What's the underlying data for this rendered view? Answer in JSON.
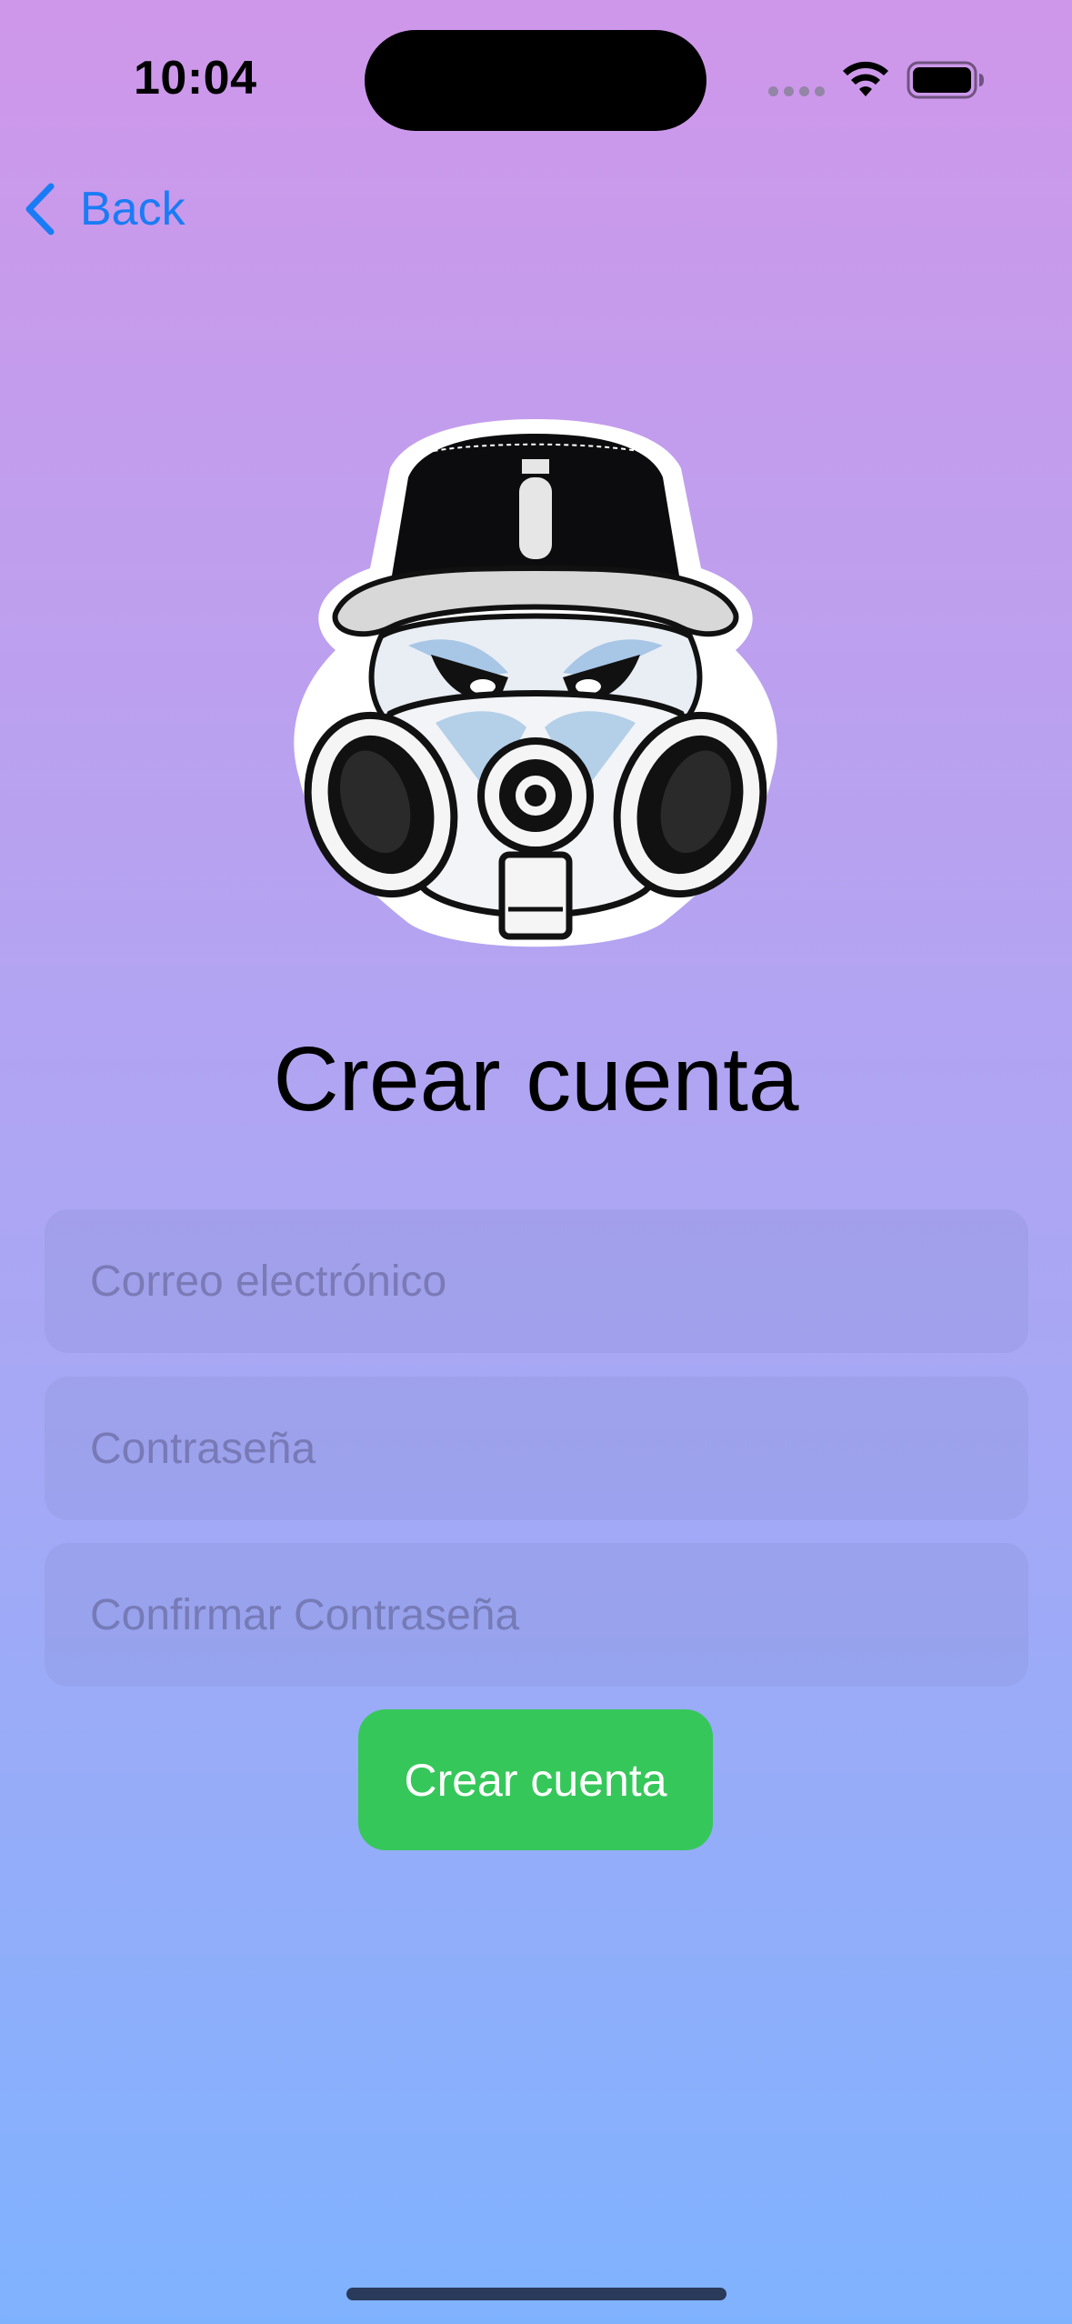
{
  "status_bar": {
    "time": "10:04",
    "icons": [
      "signal-dots-icon",
      "wifi-icon",
      "battery-icon"
    ]
  },
  "nav": {
    "back_label": "Back",
    "back_icon": "chevron-left-icon",
    "accent_color": "#1a7cf5"
  },
  "logo": {
    "icon": "gas-mask-graffiti-logo"
  },
  "form": {
    "title": "Crear cuenta",
    "email_placeholder": "Correo electrónico",
    "email_value": "",
    "password_placeholder": "Contraseña",
    "password_value": "",
    "confirm_placeholder": "Confirmar Contraseña",
    "confirm_value": "",
    "submit_label": "Crear cuenta",
    "submit_color": "#36c75a"
  }
}
